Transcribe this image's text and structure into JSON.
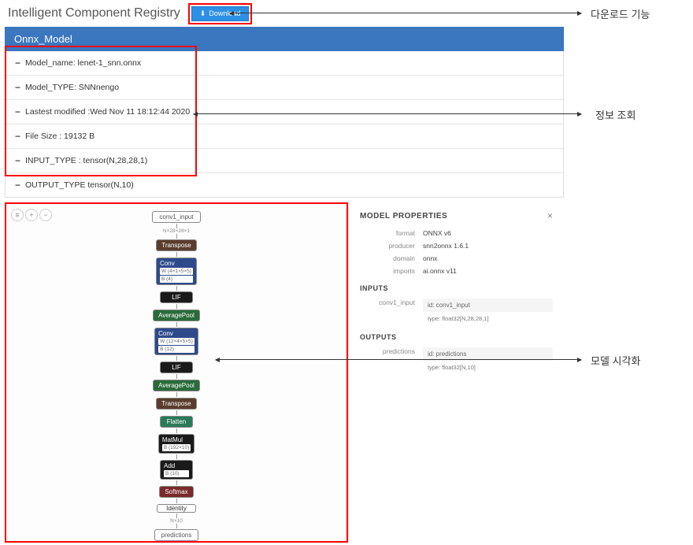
{
  "header": {
    "title": "Intelligent Component Registry",
    "download_label": "Download"
  },
  "model": {
    "name": "Onnx_Model"
  },
  "info": {
    "model_name": "Model_name: lenet-1_snn.onnx",
    "model_type": "Model_TYPE: SNNnengo",
    "modified": "Lastest modified :Wed Nov 11 18:12:44 2020",
    "file_size": "File Size : 19132 B",
    "input_type": "INPUT_TYPE : tensor(N,28,28,1)",
    "output_type": "OUTPUT_TYPE tensor(N,10)"
  },
  "graph": {
    "nodes": {
      "input": "conv1_input",
      "shape_in": "N×28×28×1",
      "transpose": "Transpose",
      "conv": "Conv",
      "conv_w": "W (4×1×5×5)",
      "conv_b": "B (4)",
      "lif": "LIF",
      "avgpool": "AveragePool",
      "conv2_w": "W (12×4×5×5)",
      "conv2_b": "B (12)",
      "flatten": "Flatten",
      "matmul": "MatMul",
      "matmul_b": "B (192×10)",
      "add": "Add",
      "add_b": "B (10)",
      "softmax": "Softmax",
      "identity": "Identity",
      "shape_out": "N×10",
      "output": "predictions"
    }
  },
  "props": {
    "title": "MODEL PROPERTIES",
    "format_label": "format",
    "format": "ONNX v6",
    "producer_label": "producer",
    "producer": "snn2onnx 1.6.1",
    "domain_label": "domain",
    "domain": "onnx",
    "imports_label": "imports",
    "imports": "ai.onnx v11",
    "inputs_label": "INPUTS",
    "input_name_label": "conv1_input",
    "input_id": "id: conv1_input",
    "input_type": "type: float32[N,28,28,1]",
    "outputs_label": "OUTPUTS",
    "output_name_label": "predictions",
    "output_id": "id: predictions",
    "output_type": "type: float32[N,10]"
  },
  "annotations": {
    "download": "다운로드 기능",
    "info": "정보 조회",
    "viz": "모델 시각화"
  }
}
